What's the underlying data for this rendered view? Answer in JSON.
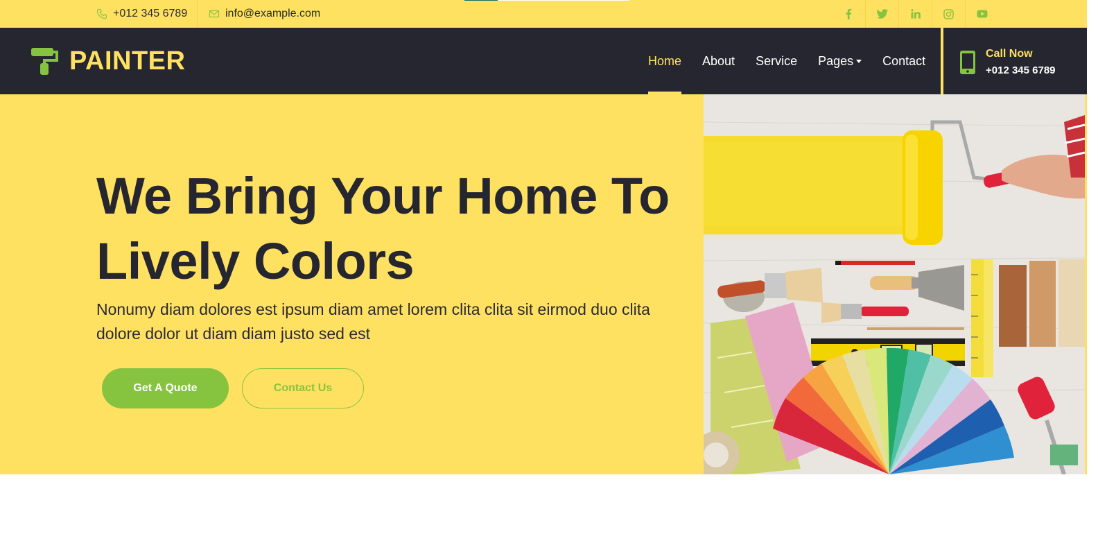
{
  "topbar": {
    "phone": "+012 345 6789",
    "email": "info@example.com",
    "socials": [
      "facebook-icon",
      "twitter-icon",
      "linkedin-icon",
      "instagram-icon",
      "youtube-icon"
    ]
  },
  "brand": {
    "name": "PAINTER"
  },
  "nav": {
    "items": [
      {
        "label": "Home",
        "active": true
      },
      {
        "label": "About"
      },
      {
        "label": "Service"
      },
      {
        "label": "Pages",
        "dropdown": true
      },
      {
        "label": "Contact"
      }
    ]
  },
  "call": {
    "label": "Call Now",
    "number": "+012 345 6789"
  },
  "hero": {
    "title": "We Bring Your Home To Lively Colors",
    "text": "Nonumy diam dolores est ipsum diam amet lorem clita clita sit eirmod duo clita dolore dolor ut diam diam justo sed est",
    "primary_button": "Get A Quote",
    "secondary_button": "Contact Us"
  },
  "colors": {
    "yellow": "#FFE162",
    "dark": "#262630",
    "green": "#86C440"
  }
}
